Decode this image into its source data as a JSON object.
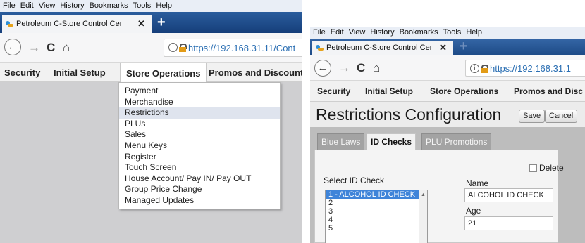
{
  "browser": {
    "menus": [
      "File",
      "Edit",
      "View",
      "History",
      "Bookmarks",
      "Tools",
      "Help"
    ],
    "tab_title_left": "Petroleum C-Store Control Cer",
    "tab_title_right": "Petroleum C-Store Control Cer",
    "tab_close": "✕",
    "new_tab": "+",
    "url_left": "https://192.168.31.11/Cont",
    "url_right": "https://192.168.31.1",
    "info_glyph": "i",
    "back_glyph": "←",
    "forward_glyph": "→",
    "reload_glyph": "C",
    "home_glyph": "⌂"
  },
  "app_menu": {
    "items": [
      "Security",
      "Initial Setup",
      "Store Operations",
      "Promos and Discounts"
    ],
    "right_last": "Promos and Disc"
  },
  "store_operations_dropdown": {
    "items": [
      "Payment",
      "Merchandise",
      "Restrictions",
      "PLUs",
      "Sales",
      "Menu Keys",
      "Register",
      "Touch Screen",
      "House Account/ Pay IN/ Pay OUT",
      "Group Price Change",
      "Managed Updates"
    ],
    "highlighted": "Restrictions"
  },
  "restrictions": {
    "title": "Restrictions Configuration",
    "save_label": "Save",
    "cancel_label": "Cancel",
    "tabs": [
      "Blue Laws",
      "ID Checks",
      "PLU Promotions"
    ],
    "active_tab": "ID Checks",
    "delete_label": "Delete",
    "select_label": "Select ID Check",
    "list": [
      "1 - ALCOHOL ID CHECK",
      "2",
      "3",
      "4",
      "5"
    ],
    "name_label": "Name",
    "name_value": "ALCOHOL ID CHECK",
    "age_label": "Age",
    "age_value": "21"
  },
  "icons": {
    "favicon": "favicon-icon",
    "lock": "lock-warning-icon",
    "info": "info-icon",
    "scroll_up": "scroll-up-icon"
  }
}
